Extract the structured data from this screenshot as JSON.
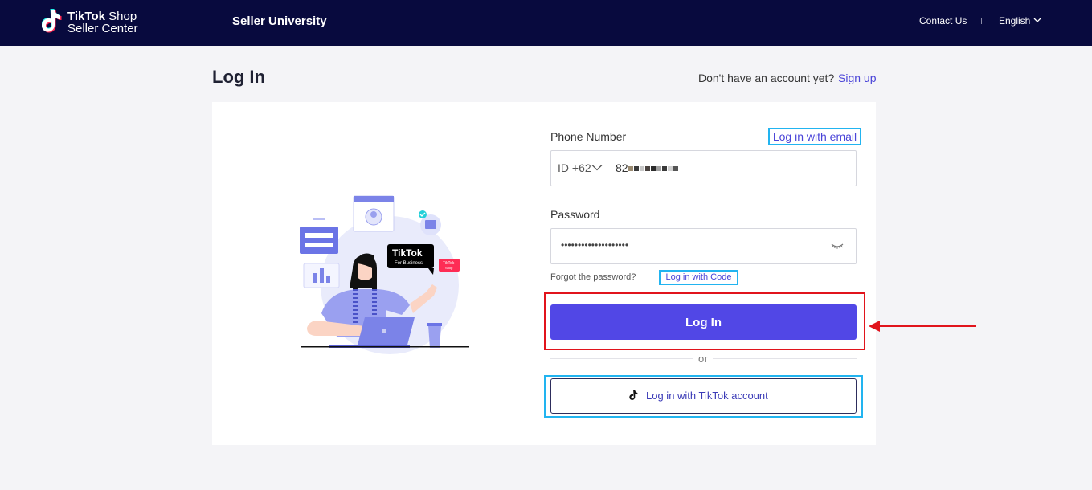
{
  "header": {
    "logo_brand": "TikTok",
    "logo_suffix": "Shop",
    "logo_line2": "Seller Center",
    "nav_university": "Seller University",
    "nav_contact": "Contact Us",
    "nav_language": "English"
  },
  "page": {
    "title": "Log In",
    "signup_prompt": "Don't have an account yet?",
    "signup_link": "Sign up"
  },
  "form": {
    "phone_label": "Phone Number",
    "email_link": "Log in with email",
    "country_code": "ID +62",
    "phone_value": "82",
    "password_label": "Password",
    "password_value": "••••••••••••••••••••",
    "forgot_link": "Forgot the password?",
    "code_link": "Log in with Code",
    "login_button": "Log In",
    "or_text": "or",
    "tiktok_button": "Log in with TikTok account"
  },
  "illustration": {
    "badge_title": "TikTok",
    "badge_sub": "For Business",
    "shop_tag_line1": "TikTok",
    "shop_tag_line2": "Shop"
  },
  "colors": {
    "header_bg": "#080a3e",
    "primary": "#5147e6",
    "link": "#4a44d8",
    "highlight_blue": "#22b4f0",
    "highlight_red": "#e1141c"
  }
}
